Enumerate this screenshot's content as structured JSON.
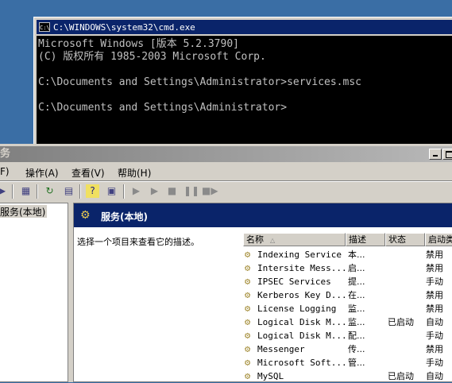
{
  "cmd": {
    "title": "C:\\WINDOWS\\system32\\cmd.exe",
    "icon_label": "C:\\",
    "lines": [
      "Microsoft Windows [版本 5.2.3790]",
      "(C) 版权所有 1985-2003 Microsoft Corp.",
      "",
      "C:\\Documents and Settings\\Administrator>services.msc",
      "",
      "C:\\Documents and Settings\\Administrator>"
    ]
  },
  "mmc": {
    "title": "务",
    "menu": [
      "F)",
      "操作(A)",
      "查看(V)",
      "帮助(H)"
    ],
    "toolbar_icons": [
      "back-icon",
      "show-tree-icon",
      "refresh-icon",
      "export-list-icon",
      "help-icon",
      "action-pane-icon",
      "start-service-icon",
      "start-service-alt-icon",
      "stop-service-icon",
      "pause-service-icon",
      "restart-service-icon"
    ],
    "tree_item": "服务(本地)",
    "header_title": "服务(本地)",
    "description_prompt": "选择一个项目来查看它的描述。",
    "columns": [
      "名称",
      "描述",
      "状态",
      "启动类"
    ],
    "services": [
      {
        "name": "Indexing Service",
        "desc": "本...",
        "status": "",
        "startup": "禁用"
      },
      {
        "name": "Intersite Mess...",
        "desc": "启...",
        "status": "",
        "startup": "禁用"
      },
      {
        "name": "IPSEC Services",
        "desc": "提...",
        "status": "",
        "startup": "手动"
      },
      {
        "name": "Kerberos Key D...",
        "desc": "在...",
        "status": "",
        "startup": "禁用"
      },
      {
        "name": "License Logging",
        "desc": "监...",
        "status": "",
        "startup": "禁用"
      },
      {
        "name": "Logical Disk M...",
        "desc": "监...",
        "status": "已启动",
        "startup": "自动"
      },
      {
        "name": "Logical Disk M...",
        "desc": "配...",
        "status": "",
        "startup": "手动"
      },
      {
        "name": "Messenger",
        "desc": "传...",
        "status": "",
        "startup": "禁用"
      },
      {
        "name": "Microsoft Soft...",
        "desc": "管...",
        "status": "",
        "startup": "手动"
      },
      {
        "name": "MySQL",
        "desc": "",
        "status": "已启动",
        "startup": "自动"
      }
    ]
  }
}
